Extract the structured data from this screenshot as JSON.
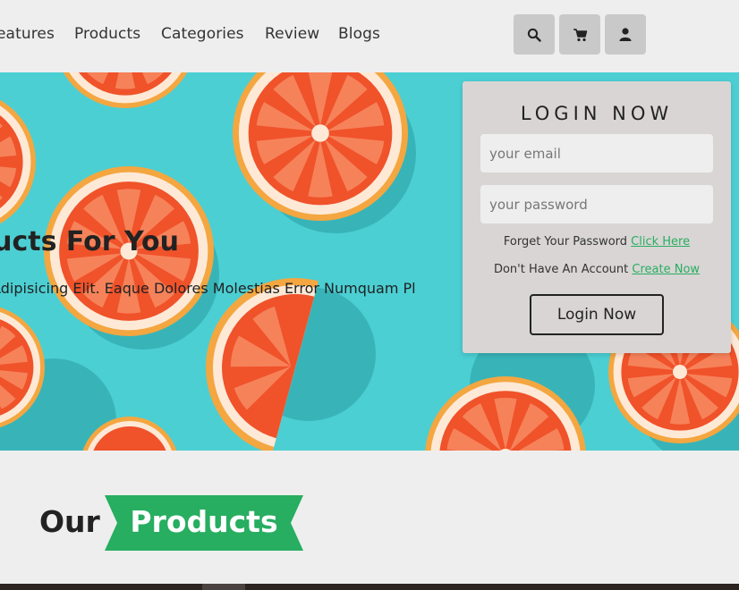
{
  "nav": {
    "links": [
      "eatures",
      "Products",
      "Categories",
      "Review",
      "Blogs"
    ]
  },
  "icons": [
    "search-icon",
    "cart-icon",
    "user-icon"
  ],
  "hero": {
    "title": "oducts For You",
    "description": "tur Adipisicing Elit. Eaque Dolores Molestias Error Numquam Pl"
  },
  "login": {
    "title": "LOGIN NOW",
    "email_placeholder": "your email",
    "password_placeholder": "your password",
    "forgot_text": "Forget Your Password",
    "forgot_link": "Click Here",
    "account_text": "Don't Have An Account",
    "account_link": "Create Now",
    "button_label": "Login Now"
  },
  "section": {
    "heading_plain": "Our",
    "heading_highlight": "Products"
  },
  "colors": {
    "accent": "#27ae60",
    "hero_bg": "#4bcfd3",
    "panel_bg": "#d9d5d5"
  }
}
